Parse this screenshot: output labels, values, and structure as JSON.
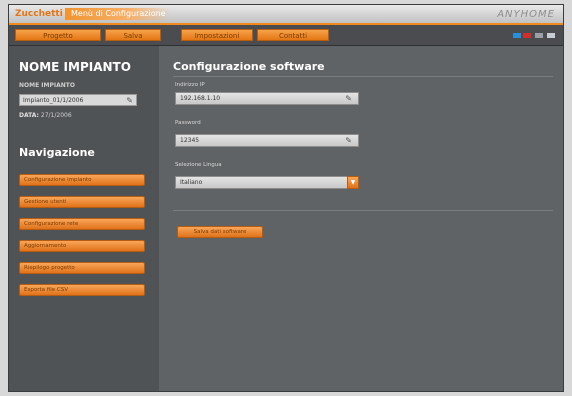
{
  "titlebar": {
    "app_logo": "Zucchetti",
    "window_title": "Menù di Configurazione",
    "brand_logo": "ANYHOME"
  },
  "menu": {
    "tabs": [
      "Progetto",
      "Salva",
      "Impostazioni",
      "Contatti"
    ]
  },
  "sidebar": {
    "title": "NOME IMPIANTO",
    "system_name_label": "NOME IMPIANTO",
    "system_name_value": "Impianto_01/1/2006",
    "date_label": "DATA:",
    "date_value": "27/1/2006",
    "nav_title": "Navigazione",
    "nav_items": [
      "Configurazione impianto",
      "Gestione utenti",
      "Configurazione rete",
      "Aggiornamento",
      "Riepilogo progetto",
      "Esporta file CSV"
    ]
  },
  "main": {
    "title": "Configurazione software",
    "ip_label": "Indirizzo IP",
    "ip_value": "192.168.1.10",
    "password_label": "Password",
    "password_value": "12345",
    "language_label": "Selezione Lingua",
    "language_value": "Italiano",
    "action_button": "Salva dati software"
  },
  "colors": {
    "accent": "#f08a1d",
    "panel": "#606366",
    "sidebar": "#505356"
  }
}
